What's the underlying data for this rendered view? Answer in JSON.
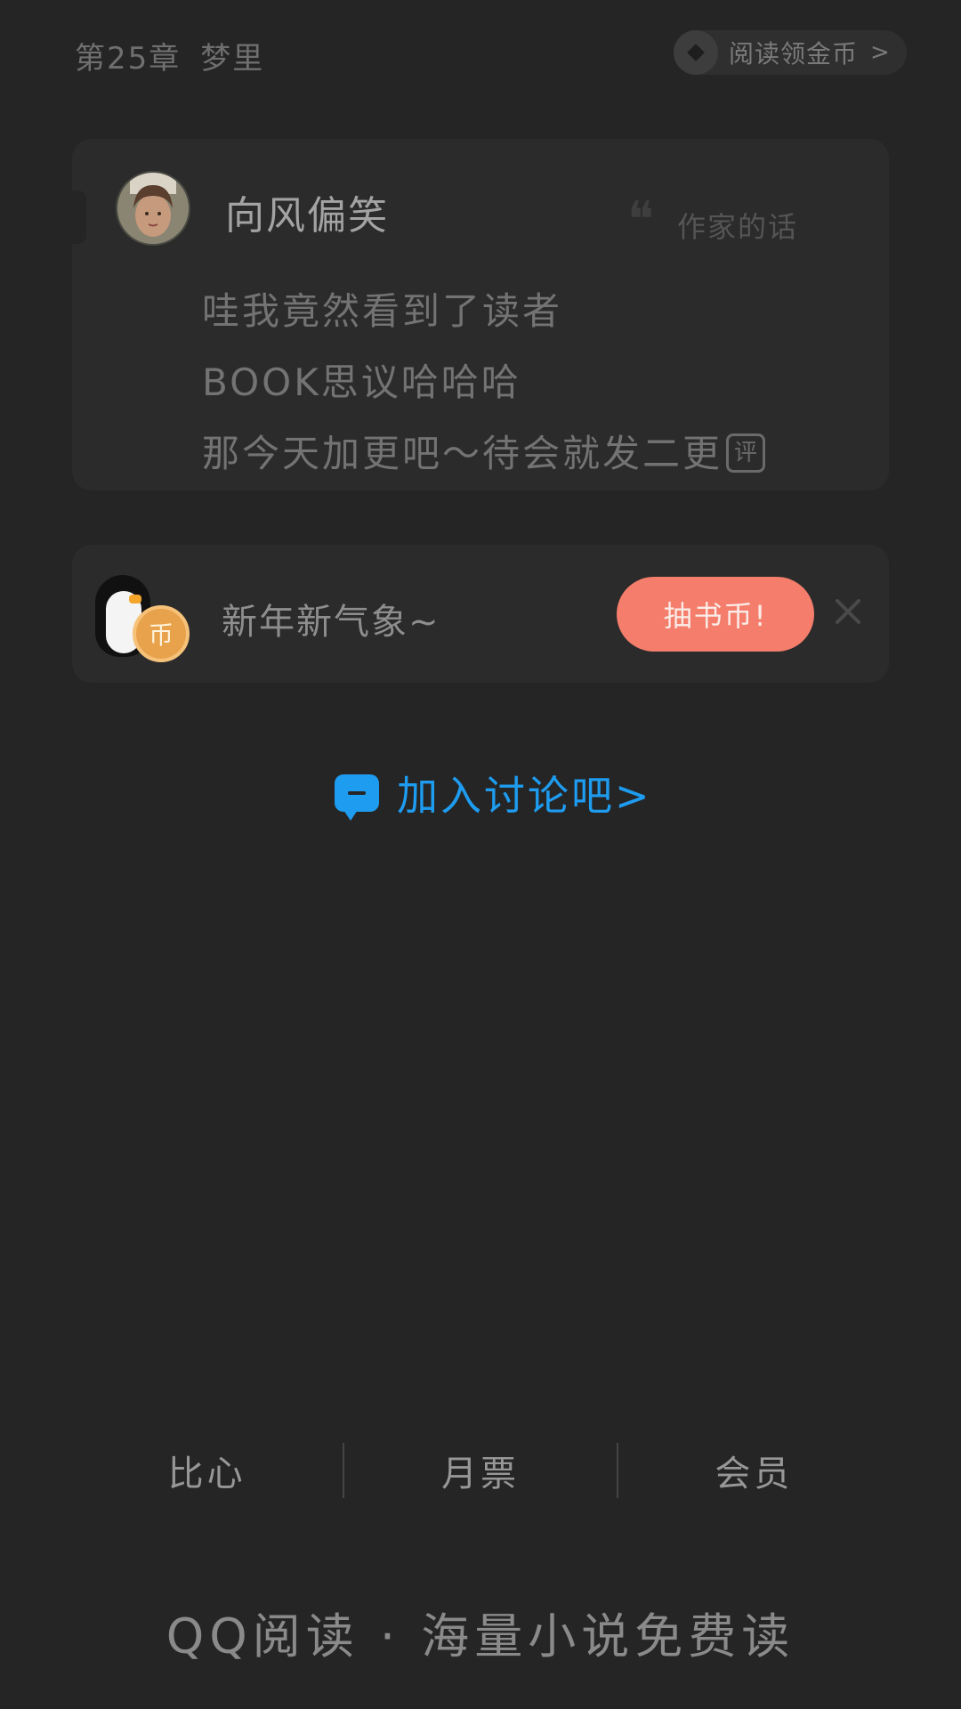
{
  "header": {
    "chapter_number": "第25章",
    "chapter_title": "梦里",
    "reward_pill_label": "阅读领金币",
    "reward_pill_arrow": ">"
  },
  "author_card": {
    "author_name": "向风偏笑",
    "section_label": "作家的话",
    "quote_glyph": "❝",
    "message_lines": [
      "哇我竟然看到了读者",
      "BOOK思议哈哈哈",
      "那今天加更吧～待会就发二更"
    ],
    "comment_tag": "评"
  },
  "promo_card": {
    "text": "新年新气象~",
    "coin_glyph": "币",
    "button_label": "抽书币!"
  },
  "discussion": {
    "link_text": "加入讨论吧>"
  },
  "actions": [
    {
      "label": "比心"
    },
    {
      "label": "月票"
    },
    {
      "label": "会员"
    }
  ],
  "footer": {
    "slogan": "QQ阅读 · 海量小说免费读"
  },
  "colors": {
    "background": "#252525",
    "card": "#2b2b2b",
    "accent_blue": "#1e9cf0",
    "button_coral": "#f47e6b"
  },
  "icons": [
    "quote-icon",
    "penguin-coin-icon",
    "close-icon",
    "chat-bubble-icon",
    "coin-ring-icon"
  ]
}
